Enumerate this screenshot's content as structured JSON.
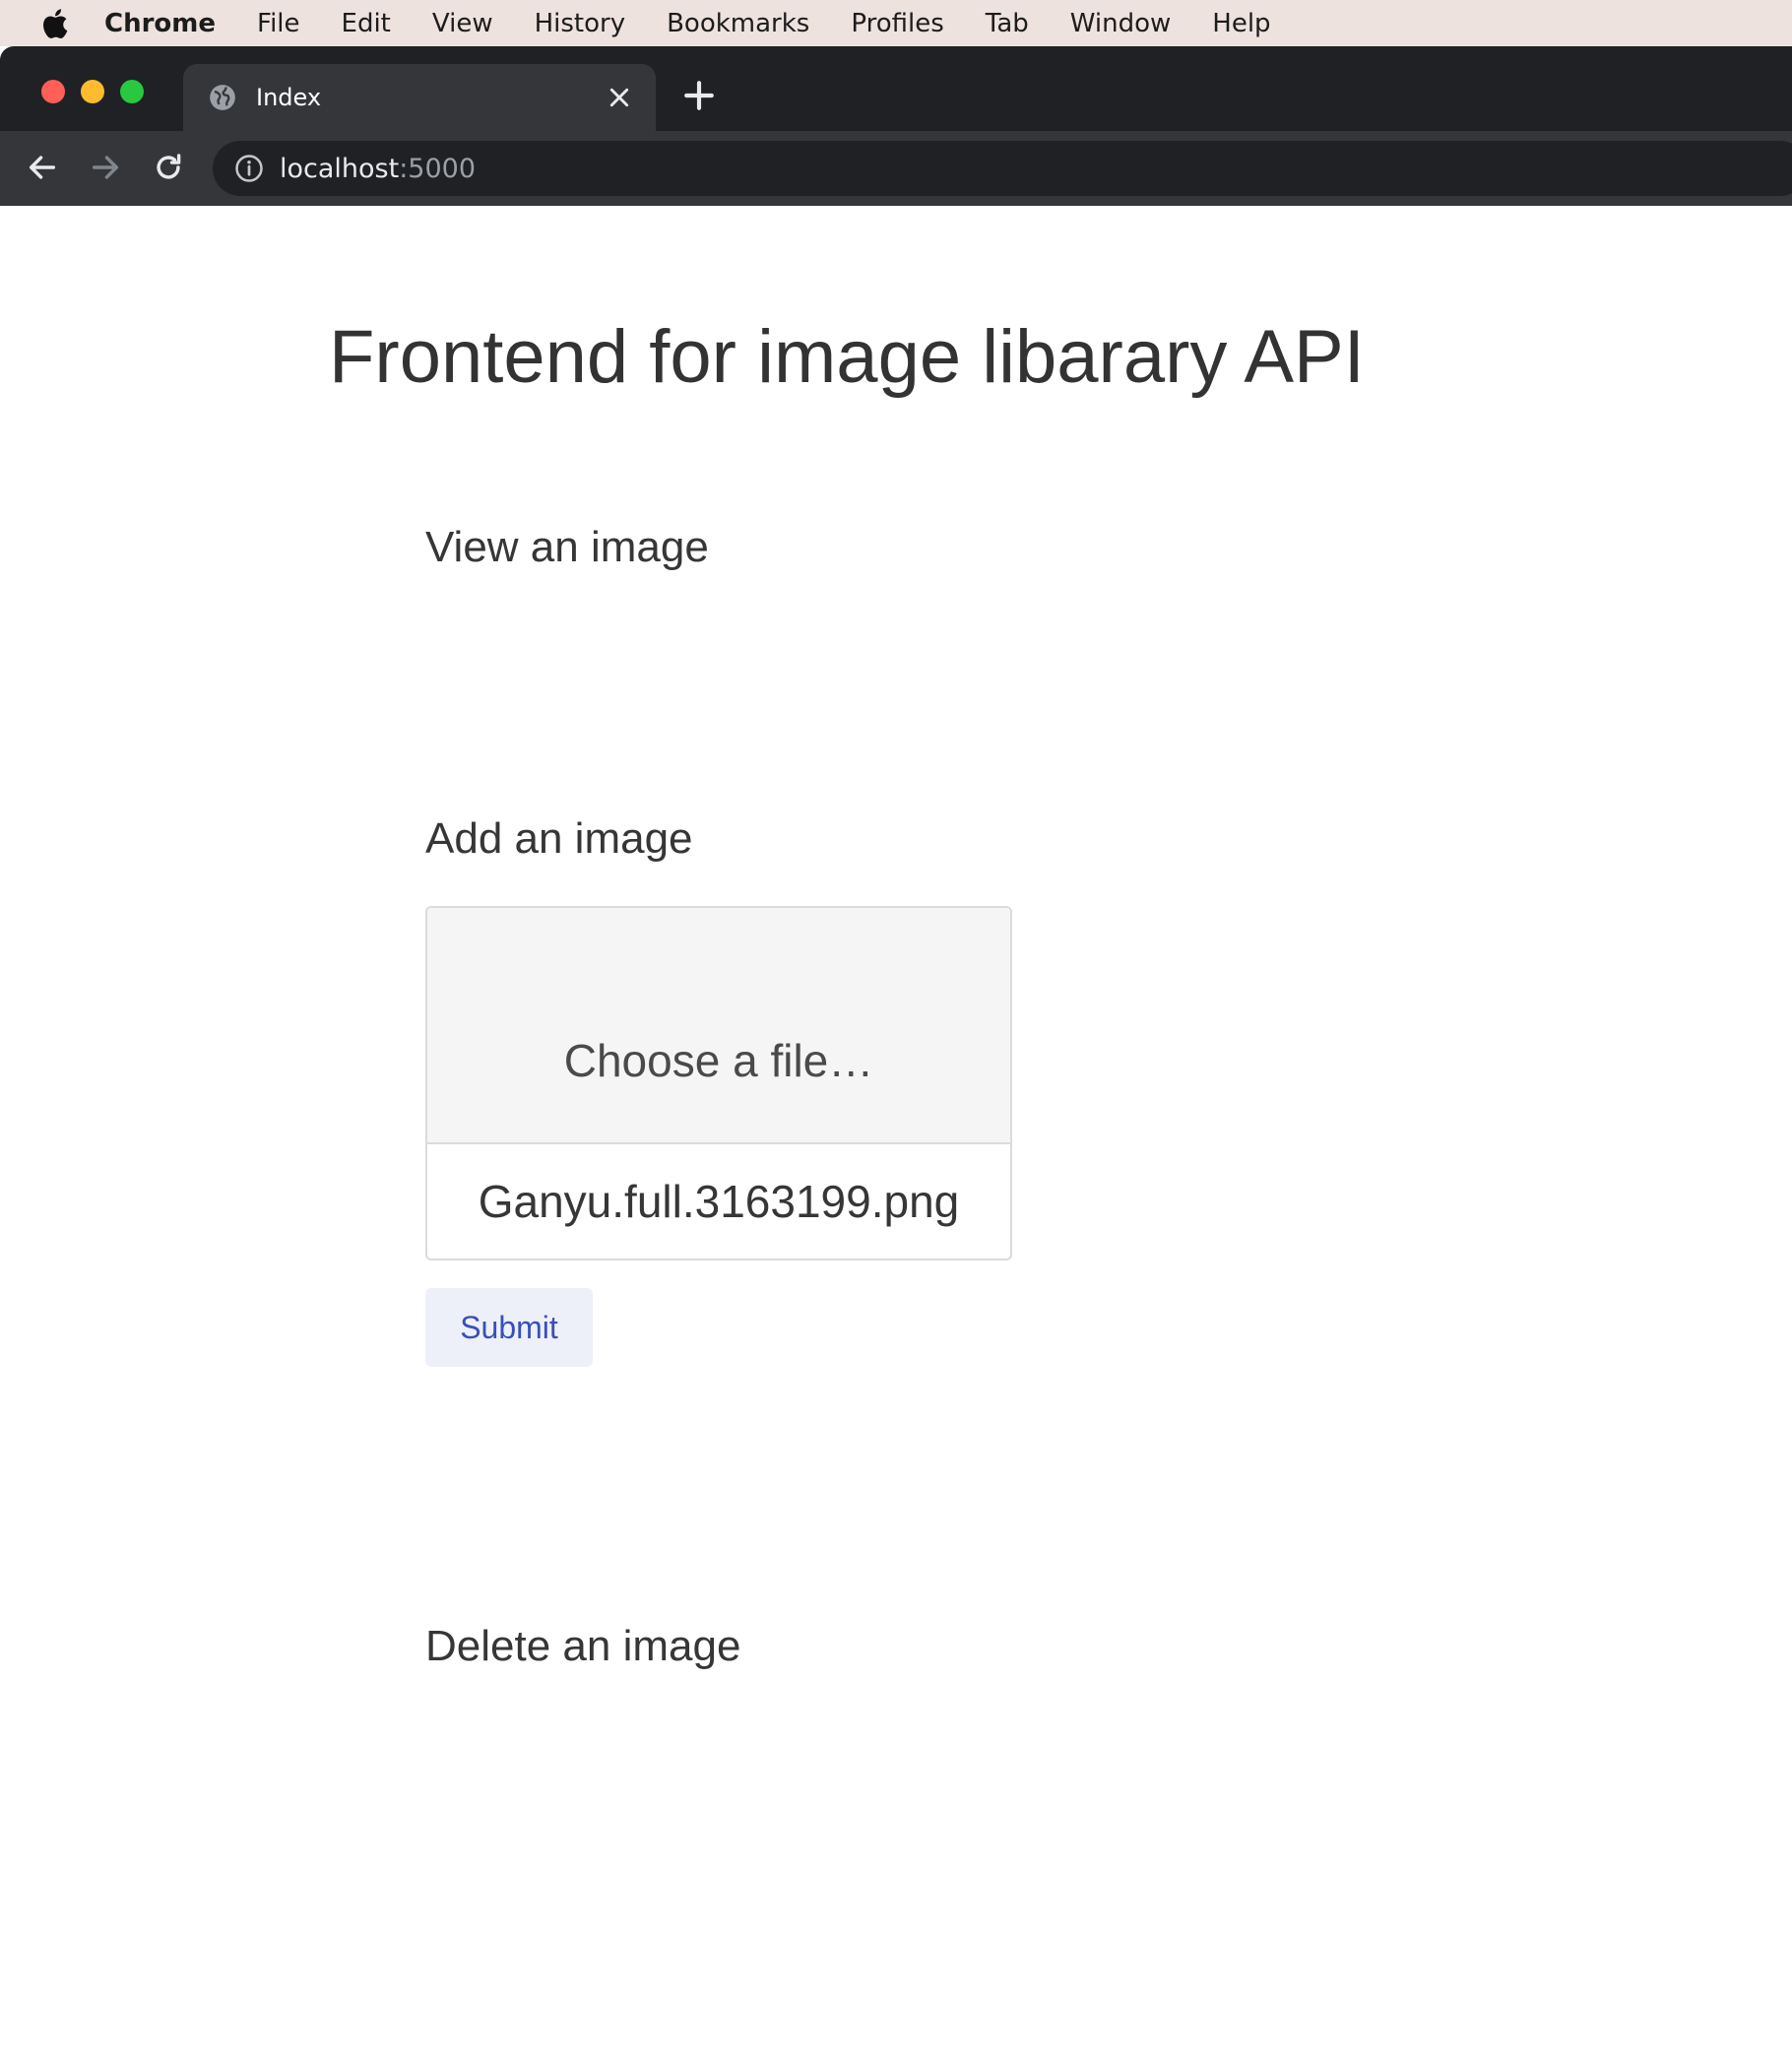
{
  "menubar": {
    "app_name": "Chrome",
    "items": [
      "File",
      "Edit",
      "View",
      "History",
      "Bookmarks",
      "Profiles",
      "Tab",
      "Window",
      "Help"
    ]
  },
  "browser": {
    "tab_title": "Index",
    "url_host": "localhost",
    "url_port": ":5000"
  },
  "page": {
    "title": "Frontend for image libarary API",
    "sections": {
      "view": {
        "heading": "View an image"
      },
      "add": {
        "heading": "Add an image",
        "file_cta": "Choose a file…",
        "file_name": "Ganyu.full.3163199.png",
        "submit_label": "Submit"
      },
      "delete": {
        "heading": "Delete an image"
      }
    }
  },
  "colors": {
    "accent": "#3850b7",
    "submit_bg": "#eef0f9",
    "browser_dark": "#202124",
    "toolbar": "#35363a"
  },
  "icons": [
    "apple-icon",
    "globe-icon",
    "close-icon",
    "plus-icon",
    "back-arrow-icon",
    "forward-arrow-icon",
    "reload-icon",
    "info-icon"
  ]
}
